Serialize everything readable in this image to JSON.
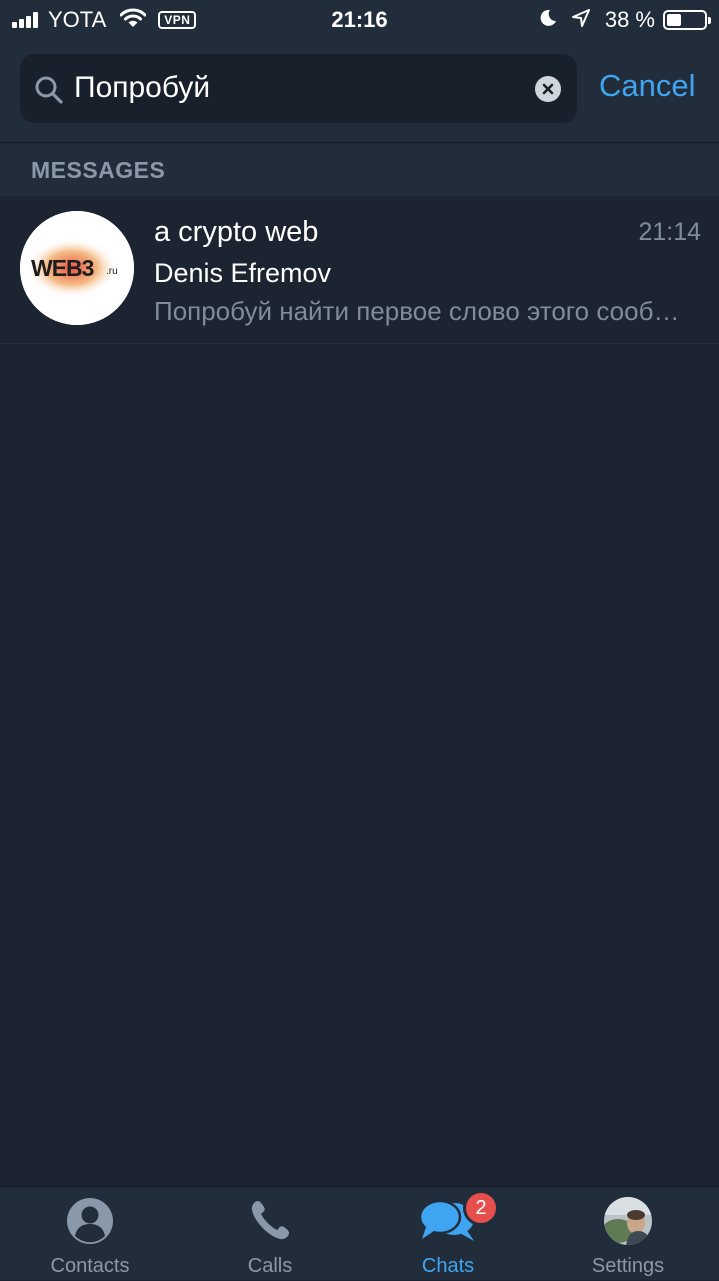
{
  "status_bar": {
    "carrier": "YOTA",
    "vpn_label": "VPN",
    "time": "21:16",
    "battery_percent": "38 %",
    "battery_level": 0.38
  },
  "search": {
    "query": "Попробуй",
    "cancel_label": "Cancel"
  },
  "section": {
    "title": "MESSAGES"
  },
  "results": [
    {
      "chat_name": "a crypto web",
      "time": "21:14",
      "sender": "Denis Efremov",
      "text": "Попробуй найти первое слово этого сообщения",
      "avatar_logo_text": "WEB3.ru"
    }
  ],
  "tab_bar": {
    "tabs": [
      {
        "label": "Contacts",
        "icon": "person-icon"
      },
      {
        "label": "Calls",
        "icon": "phone-icon"
      },
      {
        "label": "Chats",
        "icon": "chat-bubbles-icon"
      },
      {
        "label": "Settings",
        "icon": "avatar"
      }
    ],
    "chats_badge": "2",
    "active_tab": "Chats"
  },
  "colors": {
    "accent": "#3fa5f2",
    "badge": "#e5504d",
    "background": "#1b2430",
    "header": "#222d3b",
    "muted_text": "#7e8c9b"
  }
}
